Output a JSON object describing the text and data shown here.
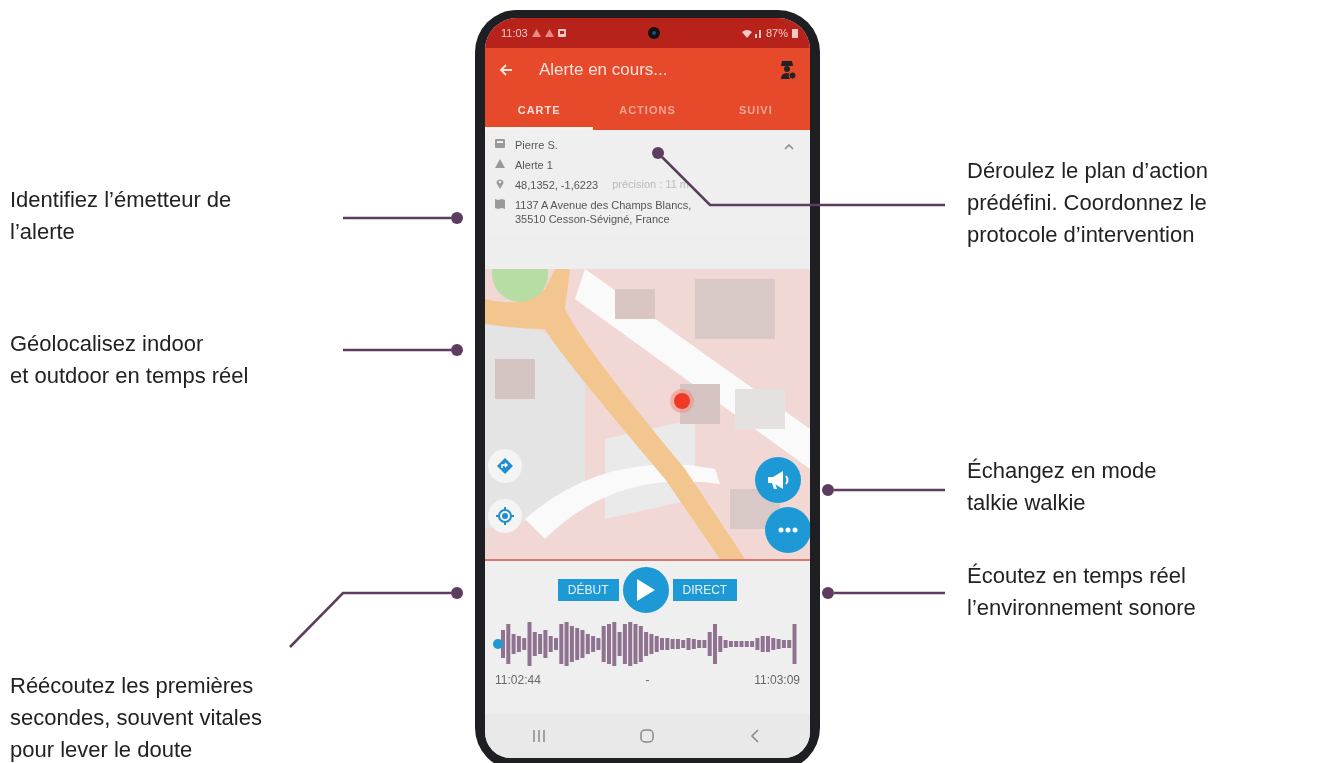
{
  "annotations": [
    {
      "text": "Identifiez l’émetteur de\nl’alerte"
    },
    {
      "text": "Géolocalisez indoor\net outdoor en temps réel"
    },
    {
      "text": "Réécoutez les premières\nsecondes, souvent vitales\npour lever le doute"
    },
    {
      "text": "Déroulez le plan d’action\nprédéfini. Coordonnez le\nprotocole d’intervention"
    },
    {
      "text": "Échangez en mode\ntalkie walkie"
    },
    {
      "text": "Écoutez en temps réel\nl’environnement sonore"
    }
  ],
  "phone": {
    "status_bar": {
      "time": "11:03",
      "battery": "87%"
    },
    "app_bar": {
      "title": "Alerte en cours..."
    },
    "tabs": [
      {
        "label": "CARTE",
        "selected": true
      },
      {
        "label": "ACTIONS",
        "selected": false
      },
      {
        "label": "SUIVI",
        "selected": false
      }
    ],
    "alert_info": {
      "expanded": true,
      "rows": [
        {
          "kind": "person",
          "text": "Pierre S."
        },
        {
          "kind": "alert",
          "text": "Alerte 1"
        },
        {
          "kind": "location",
          "text": "48,1352, -1,6223",
          "detail": "précision : 11 m"
        },
        {
          "kind": "address",
          "text": "1137 A Avenue des Champs Blancs,\n35510 Cesson-Sévigné, France"
        }
      ]
    },
    "player": {
      "start_label": "DÉBUT",
      "live_label": "DIRECT",
      "start_time": "11:02:44",
      "separator": "-",
      "end_time": "11:03:09"
    }
  }
}
